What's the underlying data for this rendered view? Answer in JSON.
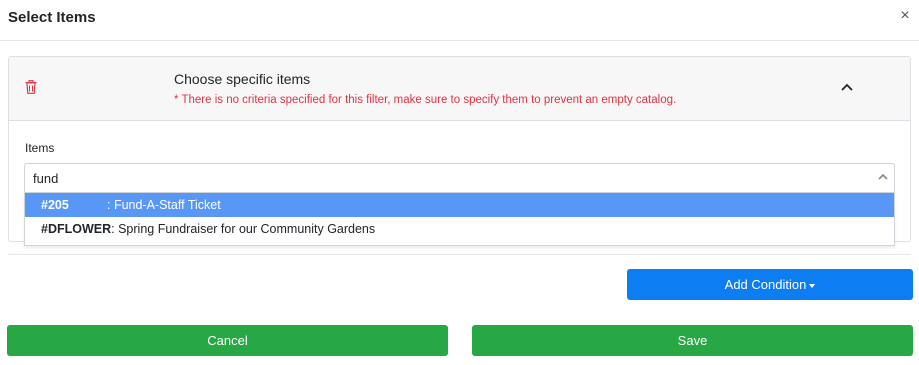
{
  "modal": {
    "title": "Select Items",
    "close_symbol": "×"
  },
  "criteria": {
    "title": "Choose specific items",
    "warning": "* There is no criteria specified for this filter, make sure to specify them to prevent an empty catalog.",
    "delete_icon": "trash-icon",
    "collapse_icon": "chevron-up-icon",
    "delete_color": "#dc3545"
  },
  "items_field": {
    "label": "Items",
    "value": "fund",
    "options": [
      {
        "code": "#205",
        "name": ": Fund-A-Staff Ticket",
        "highlighted": true
      },
      {
        "code": "#DFLOWER",
        "name": ": Spring Fundraiser for our Community Gardens",
        "highlighted": false
      }
    ],
    "highlight_color": "#5897f5"
  },
  "actions": {
    "add_condition": "Add Condition",
    "cancel": "Cancel",
    "save": "Save",
    "primary_color": "#0d7ef2",
    "success_color": "#28a745"
  }
}
